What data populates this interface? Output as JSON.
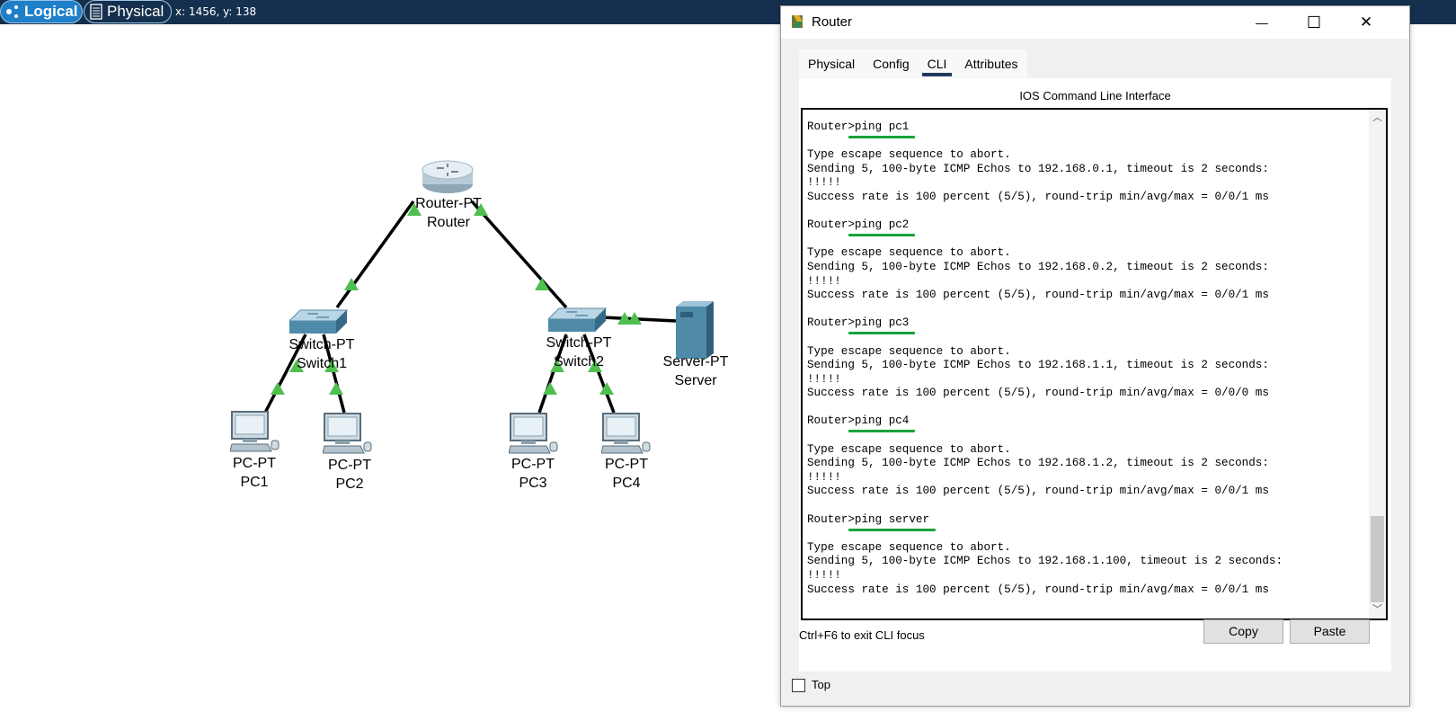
{
  "topbar": {
    "logical_label": "Logical",
    "physical_label": "Physical",
    "coords": "x: 1456, y: 138",
    "bg_color": "#15304f"
  },
  "topology": {
    "devices": [
      {
        "id": "router",
        "type_label": "Router-PT",
        "name": "Router",
        "icon": "router-icon"
      },
      {
        "id": "switch1",
        "type_label": "Switch-PT",
        "name": "Switch1",
        "icon": "switch-icon"
      },
      {
        "id": "switch2",
        "type_label": "Switch-PT",
        "name": "Switch2",
        "icon": "switch-icon"
      },
      {
        "id": "server",
        "type_label": "Server-PT",
        "name": "Server",
        "icon": "server-icon"
      },
      {
        "id": "pc1",
        "type_label": "PC-PT",
        "name": "PC1",
        "icon": "pc-icon"
      },
      {
        "id": "pc2",
        "type_label": "PC-PT",
        "name": "PC2",
        "icon": "pc-icon"
      },
      {
        "id": "pc3",
        "type_label": "PC-PT",
        "name": "PC3",
        "icon": "pc-icon"
      },
      {
        "id": "pc4",
        "type_label": "PC-PT",
        "name": "PC4",
        "icon": "pc-icon"
      }
    ],
    "link_color": "#000000",
    "link_status_color": "#4fbf4f"
  },
  "window": {
    "title": "Router",
    "minimize_label": "—",
    "maximize_label": "☐",
    "close_label": "✕",
    "tabs": [
      {
        "label": "Physical",
        "active": false
      },
      {
        "label": "Config",
        "active": false
      },
      {
        "label": "CLI",
        "active": true
      },
      {
        "label": "Attributes",
        "active": false
      }
    ],
    "cli_heading": "IOS Command Line Interface",
    "terminal_lines": [
      "Router>ping pc1",
      "",
      "Type escape sequence to abort.",
      "Sending 5, 100-byte ICMP Echos to 192.168.0.1, timeout is 2 seconds:",
      "!!!!!",
      "Success rate is 100 percent (5/5), round-trip min/avg/max = 0/0/1 ms",
      "",
      "Router>ping pc2",
      "",
      "Type escape sequence to abort.",
      "Sending 5, 100-byte ICMP Echos to 192.168.0.2, timeout is 2 seconds:",
      "!!!!!",
      "Success rate is 100 percent (5/5), round-trip min/avg/max = 0/0/1 ms",
      "",
      "Router>ping pc3",
      "",
      "Type escape sequence to abort.",
      "Sending 5, 100-byte ICMP Echos to 192.168.1.1, timeout is 2 seconds:",
      "!!!!!",
      "Success rate is 100 percent (5/5), round-trip min/avg/max = 0/0/0 ms",
      "",
      "Router>ping pc4",
      "",
      "Type escape sequence to abort.",
      "Sending 5, 100-byte ICMP Echos to 192.168.1.2, timeout is 2 seconds:",
      "!!!!!",
      "Success rate is 100 percent (5/5), round-trip min/avg/max = 0/0/1 ms",
      "",
      "Router>ping server",
      "",
      "Type escape sequence to abort.",
      "Sending 5, 100-byte ICMP Echos to 192.168.1.100, timeout is 2 seconds:",
      "!!!!!",
      "Success rate is 100 percent (5/5), round-trip min/avg/max = 0/0/1 ms"
    ],
    "highlight_color": "#18a33a",
    "hint": "Ctrl+F6 to exit CLI focus",
    "copy_label": "Copy",
    "paste_label": "Paste",
    "top_checkbox_label": "Top",
    "top_checked": false
  }
}
